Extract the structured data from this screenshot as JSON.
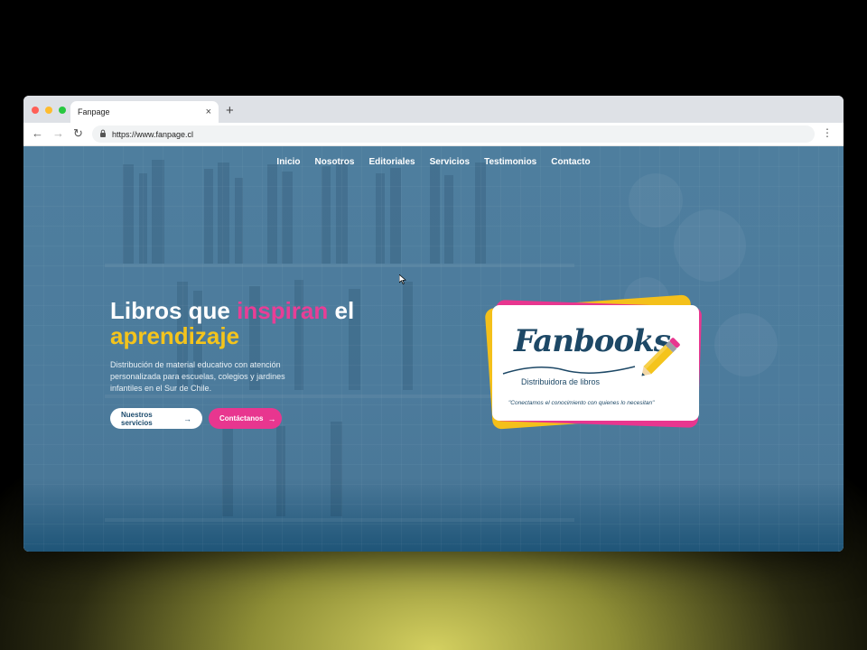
{
  "browser": {
    "tab_title": "Fanpage",
    "tab_close": "×",
    "new_tab": "+",
    "url": "https://www.fanpage.cl",
    "back": "←",
    "forward": "→",
    "reload": "↻",
    "menu": "⋮",
    "lock_icon": "🔒",
    "traffic_lights": [
      "#ff5f57",
      "#febc2e",
      "#28c840"
    ]
  },
  "nav": {
    "items": [
      "Inicio",
      "Nosotros",
      "Editoriales",
      "Servicios",
      "Testimonios",
      "Contacto"
    ]
  },
  "hero": {
    "title_part1": "Libros que ",
    "title_highlight": "inspiran",
    "title_part2": " el",
    "title_line2": "aprendizaje",
    "description": "Distribución de material educativo con atención personalizada para escuelas, colegios y jardines infantiles en el Sur de Chile.",
    "primary_button": "Nuestros servicios",
    "secondary_button": "Contáctanos",
    "arrow": "→"
  },
  "brand_card": {
    "logo_text": "Fanbooks",
    "subtitle": "Distribuidora de libros",
    "tagline": "\"Conectamos el conocimiento con quienes lo necesitan\""
  },
  "colors": {
    "accent_pink": "#e8368f",
    "accent_yellow": "#f4c41c",
    "brand_blue": "#1d4866",
    "whatsapp_green": "#25d366"
  }
}
